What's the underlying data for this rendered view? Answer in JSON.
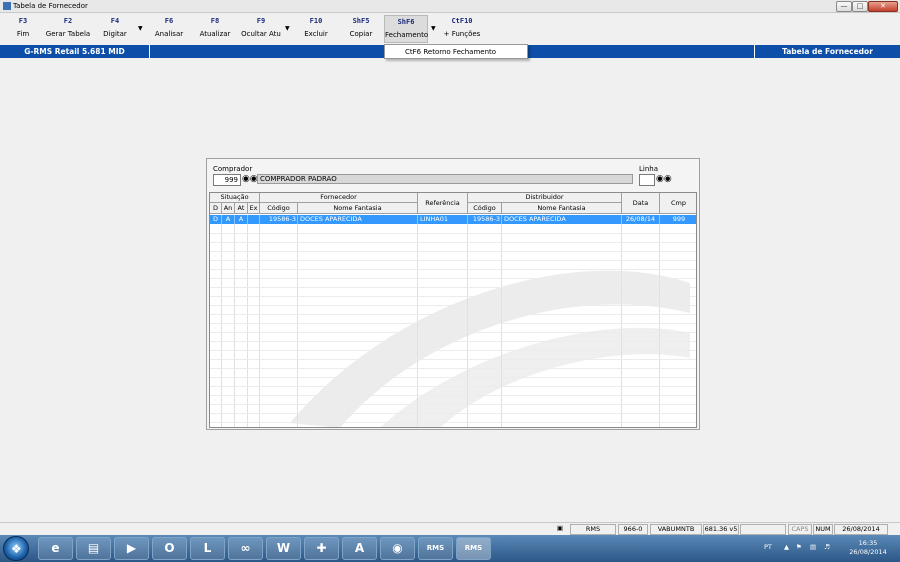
{
  "window": {
    "title": "Tabela de Fornecedor"
  },
  "toolbar": {
    "buttons": [
      {
        "key": "F3",
        "label": "Fim"
      },
      {
        "key": "F2",
        "label": "Gerar Tabela"
      },
      {
        "key": "F4",
        "label": "Digitar"
      },
      {
        "key": "F6",
        "label": "Analisar"
      },
      {
        "key": "F8",
        "label": "Atualizar"
      },
      {
        "key": "F9",
        "label": "Ocultar Atu"
      },
      {
        "key": "F10",
        "label": "Excluir"
      },
      {
        "key": "ShF5",
        "label": "Copiar"
      },
      {
        "key": "ShF6",
        "label": "Fechamento"
      },
      {
        "key": "CtF10",
        "label": "+ Funções"
      }
    ]
  },
  "dropdown": {
    "item": "CtF6  Retorno Fechamento"
  },
  "header_bar": {
    "left": "G-RMS Retail 5.681 MID",
    "right": "Tabela de Fornecedor"
  },
  "form": {
    "comprador_label": "Comprador",
    "comprador_code": "999",
    "comprador_name": "COMPRADOR PADRAO",
    "linha_label": "Linha",
    "linha_value": ""
  },
  "grid": {
    "group_headers": {
      "situacao": "Situação",
      "fornecedor": "Fornecedor",
      "referencia": "Referência",
      "distribuidor": "Distribuidor",
      "data": "Data",
      "cmp": "Cmp"
    },
    "sub_headers": {
      "d": "D",
      "an": "An",
      "at": "At",
      "ex": "Ex",
      "forn_codigo": "Código",
      "forn_nome": "Nome Fantasia",
      "dist_codigo": "Código",
      "dist_nome": "Nome Fantasia"
    },
    "rows": [
      {
        "d": "D",
        "an": "A",
        "at": "A",
        "ex": "",
        "forn_codigo": "19586-3",
        "forn_nome": "DOCES APARECIDA",
        "referencia": "LINHA01",
        "dist_codigo": "19586-3",
        "dist_nome": "DOCES APARECIDA",
        "data": "26/08/14",
        "cmp": "999"
      }
    ]
  },
  "statusbar": {
    "app": "RMS",
    "code": "966-0",
    "user": "VABUMNTB",
    "version": "681.36 v5",
    "caps": "CAPS",
    "num": "NUM",
    "date": "26/08/2014"
  },
  "taskbar": {
    "apps": [
      "windows-explorer",
      "internet-explorer",
      "file-explorer",
      "media-player",
      "outlook",
      "lync",
      "visual-studio",
      "word",
      "calculator-app",
      "acrobat",
      "network-app",
      "RMS",
      "RMS"
    ],
    "tray_lang": "PT",
    "time": "16:35",
    "date": "26/08/2014"
  }
}
